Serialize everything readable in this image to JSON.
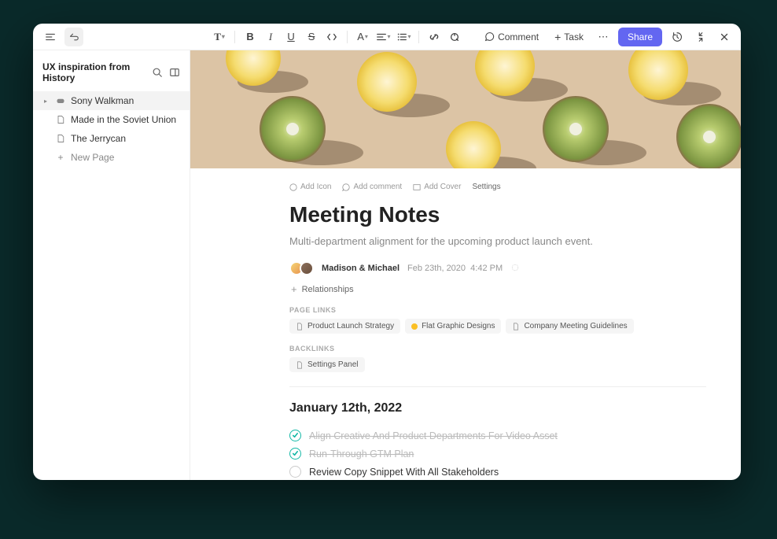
{
  "sidebar": {
    "title": "UX inspiration from History",
    "items": [
      {
        "label": "Sony Walkman",
        "icon": "gamepad",
        "active": true,
        "expandable": true
      },
      {
        "label": "Made in the Soviet Union",
        "icon": "doc",
        "active": false,
        "child": true
      },
      {
        "label": "The Jerrycan",
        "icon": "doc",
        "active": false,
        "child": true
      }
    ],
    "new_page": "New Page"
  },
  "toolbar": {
    "comment": "Comment",
    "task": "Task",
    "share": "Share"
  },
  "meta_actions": {
    "add_icon": "Add Icon",
    "add_comment": "Add comment",
    "add_cover": "Add Cover",
    "settings": "Settings"
  },
  "page": {
    "title": "Meeting Notes",
    "subtitle": "Multi-department alignment for the upcoming product launch event.",
    "authors": "Madison & Michael",
    "date": "Feb 23th, 2020",
    "time": "4:42 PM",
    "relationships": "Relationships"
  },
  "page_links": {
    "label": "PAGE LINKS",
    "items": [
      "Product Launch Strategy",
      "Flat Graphic Designs",
      "Company Meeting Guidelines"
    ]
  },
  "backlinks": {
    "label": "BACKLINKS",
    "items": [
      "Settings Panel"
    ]
  },
  "content": {
    "date_heading": "January 12th, 2022",
    "todos": [
      {
        "text": "Align Creative And Product Departments For Video Asset",
        "done": true
      },
      {
        "text": "Run-Through GTM Plan",
        "done": true
      },
      {
        "text": "Review Copy Snippet With All Stakeholders",
        "done": false
      }
    ]
  }
}
